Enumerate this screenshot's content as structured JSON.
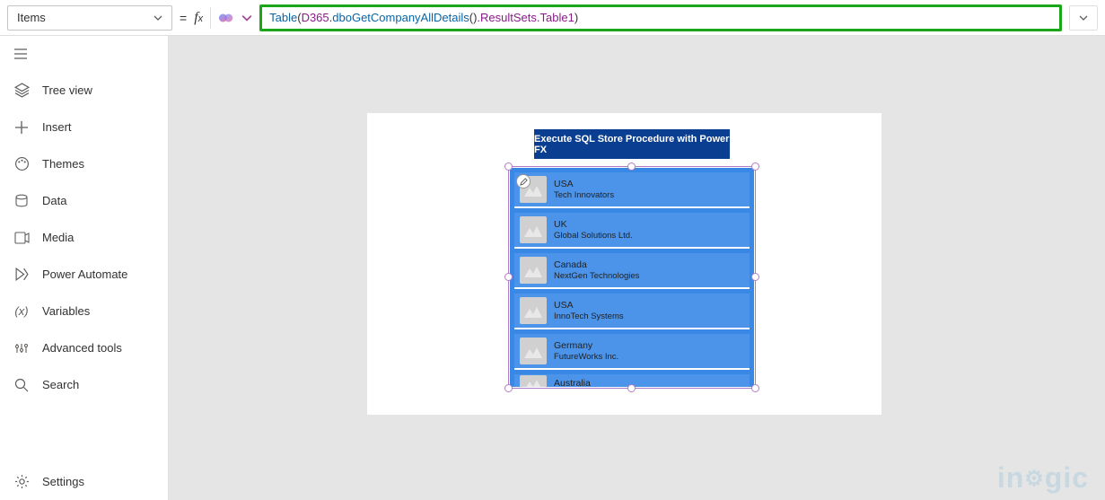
{
  "property_selector": {
    "value": "Items"
  },
  "formula": {
    "fn": "Table",
    "ident1": "D365",
    "method": "dboGetCompanyAllDetails",
    "suffix": ".ResultSets.Table1"
  },
  "sidebar": {
    "items": [
      {
        "label": "Tree view"
      },
      {
        "label": "Insert"
      },
      {
        "label": "Themes"
      },
      {
        "label": "Data"
      },
      {
        "label": "Media"
      },
      {
        "label": "Power Automate"
      },
      {
        "label": "Variables"
      },
      {
        "label": "Advanced tools"
      },
      {
        "label": "Search"
      }
    ],
    "settings_label": "Settings"
  },
  "canvas": {
    "title_button": "Execute SQL Store Procedure with Power FX",
    "gallery": [
      {
        "title": "USA",
        "subtitle": "Tech Innovators"
      },
      {
        "title": "UK",
        "subtitle": "Global Solutions Ltd."
      },
      {
        "title": "Canada",
        "subtitle": "NextGen Technologies"
      },
      {
        "title": "USA",
        "subtitle": "InnoTech Systems"
      },
      {
        "title": "Germany",
        "subtitle": "FutureWorks Inc."
      },
      {
        "title": "Australia",
        "subtitle": ""
      }
    ]
  },
  "watermark": "inogic"
}
